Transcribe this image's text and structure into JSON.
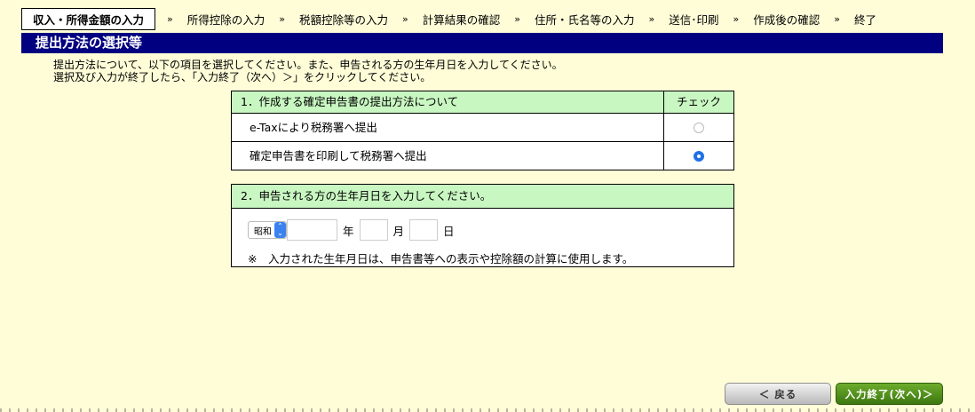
{
  "steps": {
    "items": [
      {
        "label": "収入・所得金額の入力",
        "active": true
      },
      {
        "label": "所得控除の入力"
      },
      {
        "label": "税額控除等の入力"
      },
      {
        "label": "計算結果の確認"
      },
      {
        "label": "住所・氏名等の入力"
      },
      {
        "label": "送信･印刷"
      },
      {
        "label": "作成後の確認"
      },
      {
        "label": "終了"
      }
    ],
    "separator": "»"
  },
  "page": {
    "title": "提出方法の選択等",
    "instructions": [
      "提出方法について、以下の項目を選択してください。また、申告される方の生年月日を入力してください。",
      "選択及び入力が終了したら、「入力終了（次へ）＞」をクリックしてください。"
    ]
  },
  "section1": {
    "header": "1．作成する確定申告書の提出方法について",
    "check_header": "チェック",
    "options": [
      {
        "label": "e-Taxにより税務署へ提出",
        "selected": false
      },
      {
        "label": "確定申告書を印刷して税務署へ提出",
        "selected": true
      }
    ]
  },
  "section2": {
    "header": "2．申告される方の生年月日を入力してください。",
    "era": "昭和",
    "year": "",
    "month": "",
    "day": "",
    "year_unit": "年",
    "month_unit": "月",
    "day_unit": "日",
    "note": "※　入力された生年月日は、申告書等への表示や控除額の計算に使用します。"
  },
  "buttons": {
    "back": "＜ 戻る",
    "next": "入力終了(次へ)＞"
  },
  "colors": {
    "background": "#fefdd8",
    "title_bar": "#000080",
    "section_header": "#c9f7c2",
    "radio_selected": "#1f72e6",
    "next_button": "#4f8f1c"
  }
}
